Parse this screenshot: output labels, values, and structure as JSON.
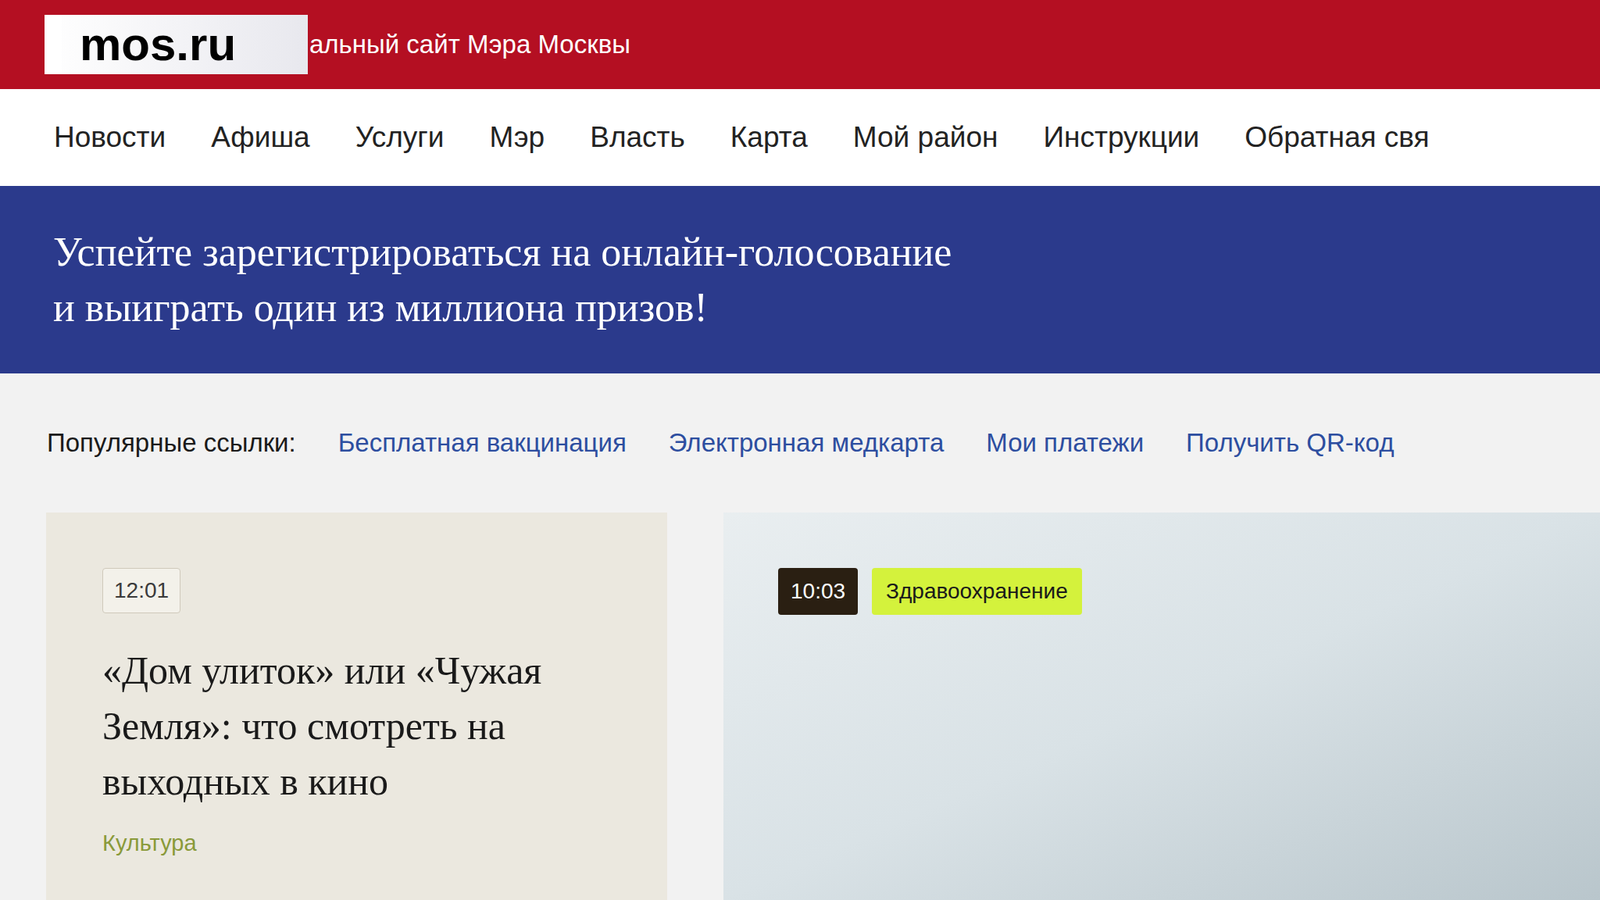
{
  "header": {
    "logo": "mos.ru",
    "tagline": "альный сайт Мэра Москвы"
  },
  "nav": {
    "items": [
      {
        "label": "Новости"
      },
      {
        "label": "Афиша"
      },
      {
        "label": "Услуги"
      },
      {
        "label": "Мэр"
      },
      {
        "label": "Власть"
      },
      {
        "label": "Карта"
      },
      {
        "label": "Мой район"
      },
      {
        "label": "Инструкции"
      },
      {
        "label": "Обратная свя"
      }
    ]
  },
  "banner": {
    "lines": [
      "Успейте зарегистрироваться на онлайн-голосование",
      "и выиграть один из миллиона призов!"
    ]
  },
  "popular": {
    "label": "Популярные ссылки:",
    "links": [
      "Бесплатная вакцинация",
      "Электронная медкарта",
      "Мои платежи",
      "Получить QR-код"
    ]
  },
  "cards": [
    {
      "kind": "text",
      "time": "12:01",
      "title": "«Дом улиток» или «Чужая Земля»: что смотреть на выходных в кино",
      "category": "Культура"
    },
    {
      "kind": "photo",
      "time": "10:03",
      "category": "Здравоохранение"
    }
  ]
}
